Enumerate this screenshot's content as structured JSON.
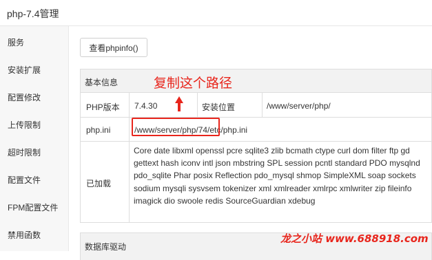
{
  "window": {
    "title": "php-7.4管理"
  },
  "sidebar": {
    "items": [
      {
        "label": "服务"
      },
      {
        "label": "安装扩展"
      },
      {
        "label": "配置修改"
      },
      {
        "label": "上传限制"
      },
      {
        "label": "超时限制"
      },
      {
        "label": "配置文件"
      },
      {
        "label": "FPM配置文件"
      },
      {
        "label": "禁用函数"
      }
    ]
  },
  "main": {
    "phpinfo_button": "查看phpinfo()",
    "info_panel": {
      "heading": "基本信息",
      "version_label": "PHP版本",
      "version_value": "7.4.30",
      "install_location_label": "安装位置",
      "install_location_value": "/www/server/php/",
      "ini_label": "php.ini",
      "ini_value": "/www/server/php/74/etc/php.ini",
      "loaded_label": "已加载",
      "loaded_extensions": "Core date libxml openssl pcre sqlite3 zlib bcmath ctype curl dom filter ftp gd gettext hash iconv intl json mbstring SPL session pcntl standard PDO mysqlnd pdo_sqlite Phar posix Reflection pdo_mysql shmop SimpleXML soap sockets sodium mysqli sysvsem tokenizer xml xmlreader xmlrpc xmlwriter zip fileinfo imagick dio swoole redis SourceGuardian xdebug"
    },
    "db_panel": {
      "heading": "数据库驱动"
    }
  },
  "annotation": {
    "text": "复制这个路径",
    "color": "#e8251c"
  },
  "watermark": {
    "text": "龙之小站 www.688918.com",
    "color": "#e8251c"
  },
  "icons": {
    "arrow": "up-arrow-icon"
  }
}
